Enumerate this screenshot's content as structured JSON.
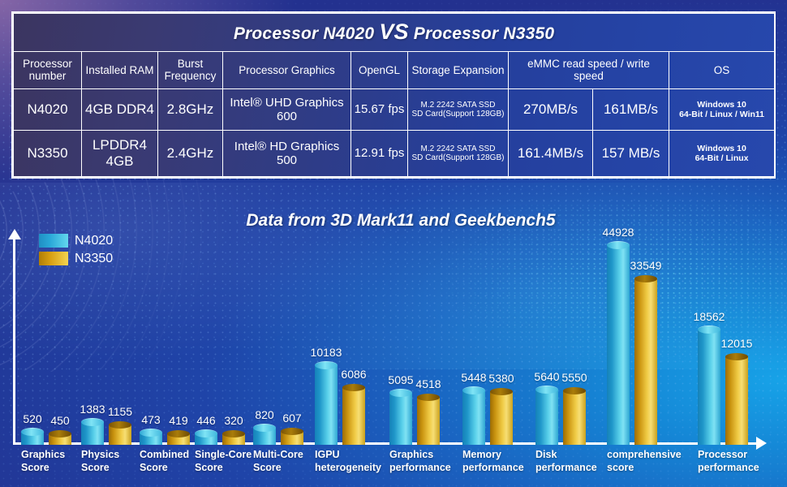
{
  "table": {
    "title_left": "Processor N4020",
    "title_vs": "VS",
    "title_right": "Processor N3350",
    "headers": [
      "Processor\nnumber",
      "Installed\nRAM",
      "Burst\nFrequency",
      "Processor Graphics",
      "OpenGL",
      "Storage\nExpansion",
      "eMMC read speed\n/ write speed",
      "OS"
    ],
    "headers_flat": {
      "processor_number": "Processor number",
      "installed_ram": "Installed RAM",
      "burst_frequency": "Burst Frequency",
      "processor_graphics": "Processor Graphics",
      "opengl": "OpenGL",
      "storage_expansion": "Storage Expansion",
      "emmc": "eMMC read speed / write speed",
      "os": "OS"
    },
    "rows": [
      {
        "processor_number": "N4020",
        "installed_ram": "4GB DDR4",
        "burst_frequency": "2.8GHz",
        "processor_graphics": "Intel® UHD Graphics 600",
        "opengl": "15.67 fps",
        "storage_expansion_l1": "M.2 2242 SATA SSD",
        "storage_expansion_l2": "SD Card(Support 128GB)",
        "emmc_read": "270MB/s",
        "emmc_write": "161MB/s",
        "os_l1": "Windows 10",
        "os_l2": "64-Bit / Linux / Win11"
      },
      {
        "processor_number": "N3350",
        "installed_ram": "LPDDR4 4GB",
        "burst_frequency": "2.4GHz",
        "processor_graphics": "Intel® HD Graphics 500",
        "opengl": "12.91 fps",
        "storage_expansion_l1": "M.2 2242 SATA SSD",
        "storage_expansion_l2": "SD Card(Support 128GB)",
        "emmc_read": "161.4MB/s",
        "emmc_write": "157 MB/s",
        "os_l1": "Windows 10",
        "os_l2": "64-Bit / Linux"
      }
    ]
  },
  "chart_data": {
    "type": "bar",
    "title": "Data from 3D Mark11 and Geekbench5",
    "xlabel": "",
    "ylabel": "",
    "grid": false,
    "legend_position": "top-left",
    "ylim": [
      0,
      48000
    ],
    "value_labels": true,
    "categories": [
      "Graphics\nScore",
      "Physics\nScore",
      "Combined\nScore",
      "Single-Core\nScore",
      "Multi-Core\nScore",
      "IGPU\nheterogeneity",
      "Graphics\nperformance",
      "Memory\nperformance",
      "Disk\nperformance",
      "comprehensive\nscore",
      "Processor\nperformance"
    ],
    "categories_flat": [
      "Graphics Score",
      "Physics Score",
      "Combined Score",
      "Single-Core Score",
      "Multi-Core Score",
      "IGPU heterogeneity",
      "Graphics performance",
      "Memory performance",
      "Disk performance",
      "comprehensive score",
      "Processor performance"
    ],
    "series": [
      {
        "name": "N4020",
        "color": "#3fb6dd",
        "values": [
          520,
          1383,
          473,
          446,
          820,
          10183,
          5095,
          5448,
          5640,
          44928,
          18562
        ]
      },
      {
        "name": "N3350",
        "color": "#e0ae1f",
        "values": [
          450,
          1155,
          419,
          320,
          607,
          6086,
          4518,
          5380,
          5550,
          33549,
          12015
        ]
      }
    ]
  },
  "legend": {
    "items": [
      {
        "label": "N4020",
        "swatch": "sw-blue"
      },
      {
        "label": "N3350",
        "swatch": "sw-gold"
      }
    ]
  }
}
